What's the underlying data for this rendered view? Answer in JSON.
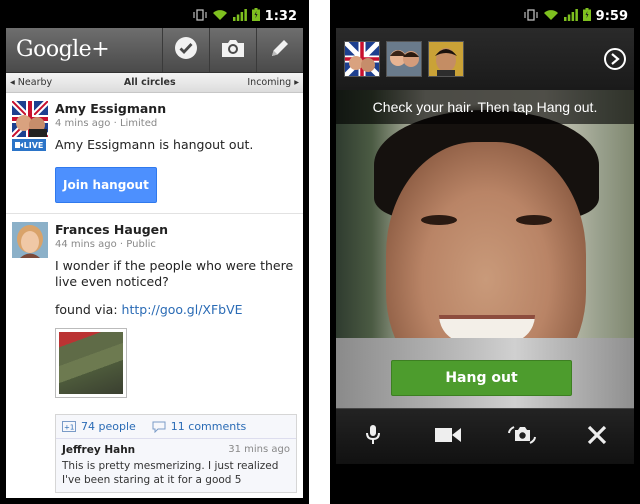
{
  "left": {
    "status": {
      "time": "1:32"
    },
    "app_bar": {
      "logo": "Google+"
    },
    "circle_bar": {
      "left": "Nearby",
      "center": "All circles",
      "right": "Incoming"
    },
    "posts": [
      {
        "author": "Amy Essigmann",
        "meta_time": "4 mins ago",
        "meta_visibility": "Limited",
        "badge": "LIVE",
        "text": "Amy Essigmann is hangout out.",
        "action_label": "Join hangout"
      },
      {
        "author": "Frances Haugen",
        "meta_time": "44 mins ago",
        "meta_visibility": "Public",
        "text": "I wonder if the people who were there live even noticed?",
        "link_prefix": "found via: ",
        "link": "http://goo.gl/XFbVE",
        "plus_count": "74 people",
        "comment_count": "11 comments",
        "comment": {
          "author": "Jeffrey Hahn",
          "time": "31 mins ago",
          "text": "This is pretty mesmerizing. I just realized I've been staring at it for a good 5"
        }
      }
    ]
  },
  "right": {
    "status": {
      "time": "9:59"
    },
    "hint": "Check your hair. Then tap Hang out.",
    "hangout_button": "Hang out"
  },
  "colors": {
    "accent_blue": "#4d90fe",
    "hangout_green": "#4d9c2d",
    "live_blue": "#2b74c8"
  }
}
